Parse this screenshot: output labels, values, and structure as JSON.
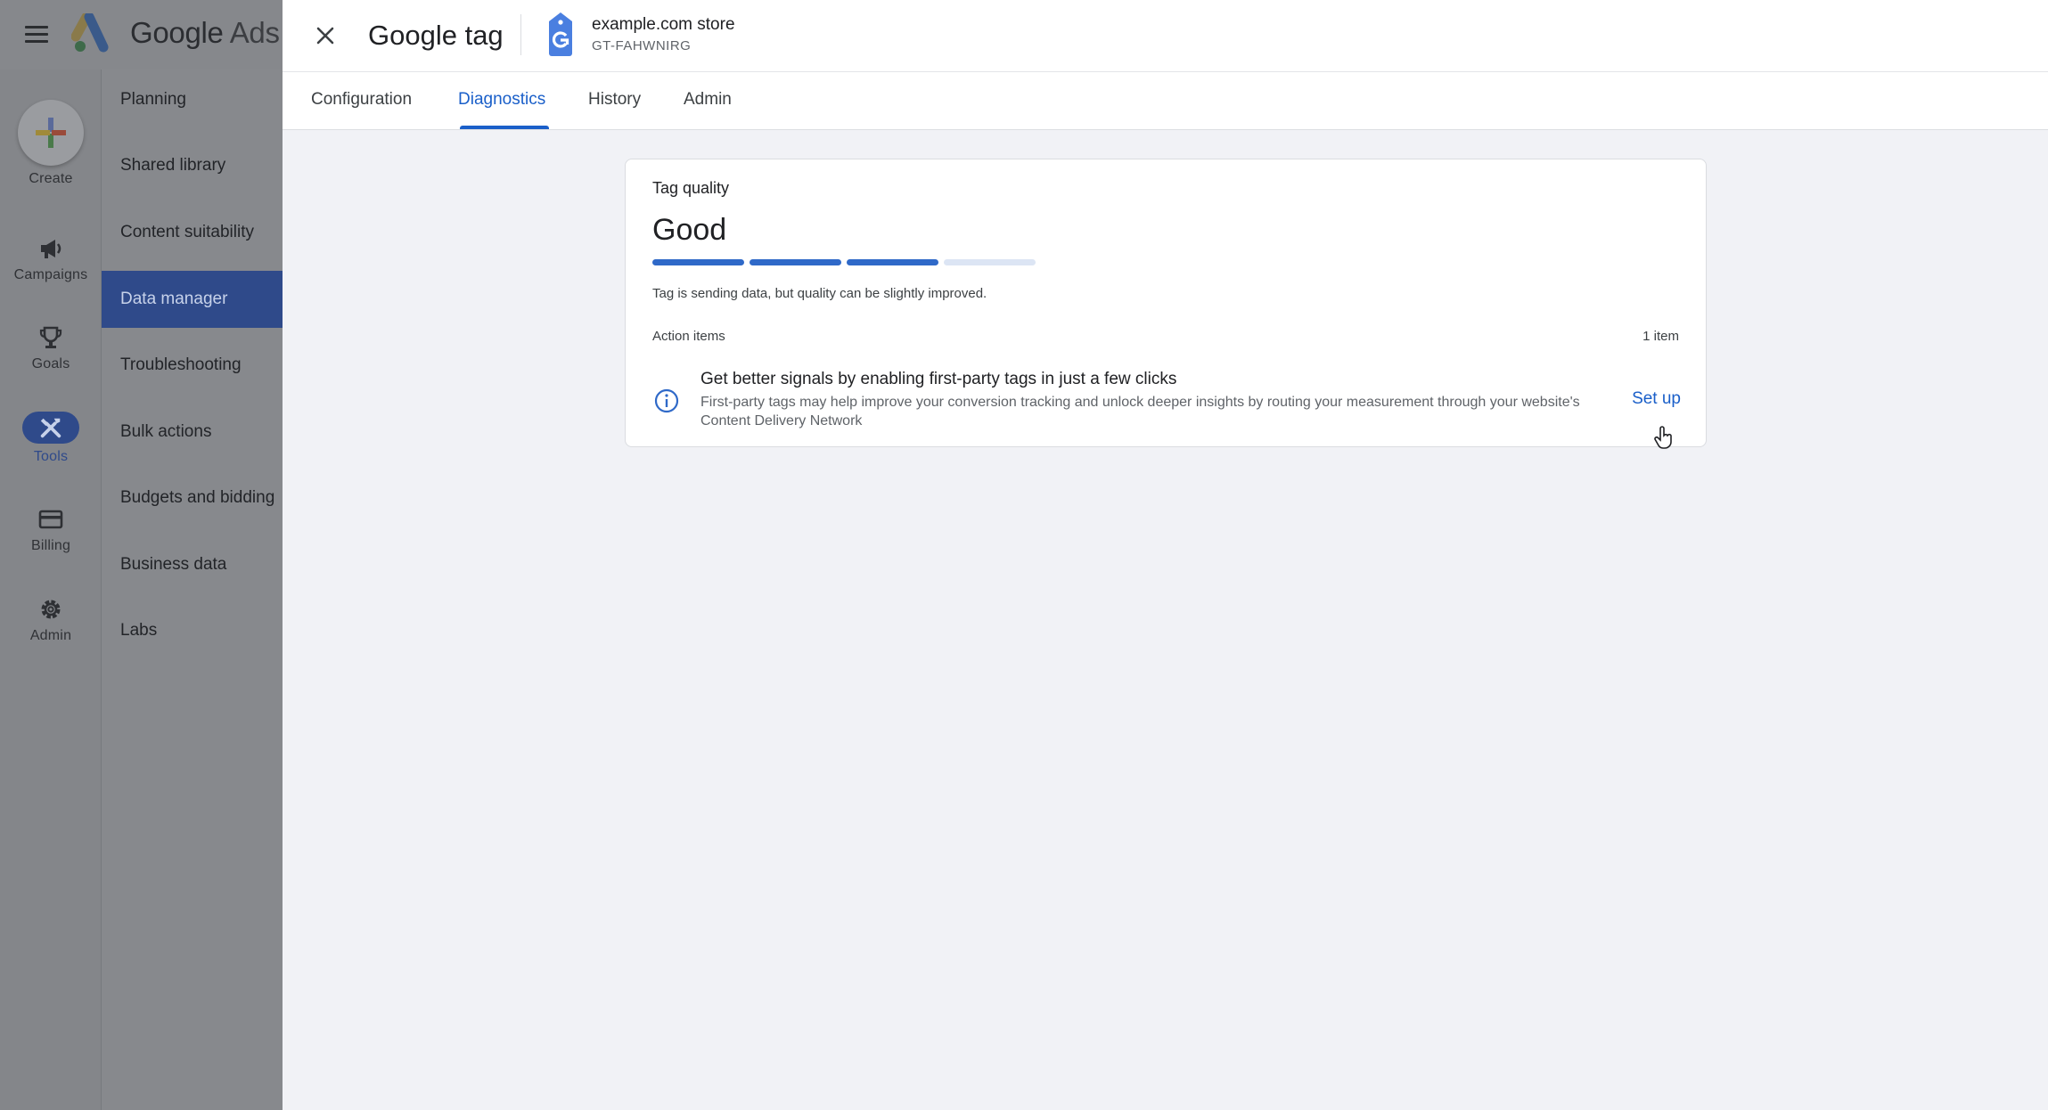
{
  "app": {
    "brand_google": "Google",
    "brand_product": "Ads"
  },
  "rail": {
    "items": [
      {
        "label": "Create",
        "icon": "plus-icon"
      },
      {
        "label": "Campaigns",
        "icon": "megaphone-icon"
      },
      {
        "label": "Goals",
        "icon": "trophy-icon"
      },
      {
        "label": "Tools",
        "icon": "tools-icon",
        "active": true
      },
      {
        "label": "Billing",
        "icon": "credit-card-icon"
      },
      {
        "label": "Admin",
        "icon": "gear-icon"
      }
    ]
  },
  "nav": {
    "items": [
      {
        "label": "Planning"
      },
      {
        "label": "Shared library"
      },
      {
        "label": "Content suitability"
      },
      {
        "label": "Data manager",
        "active": true
      },
      {
        "label": "Troubleshooting"
      },
      {
        "label": "Bulk actions"
      },
      {
        "label": "Budgets and bidding"
      },
      {
        "label": "Business data"
      },
      {
        "label": "Labs"
      }
    ]
  },
  "header": {
    "title": "Google tag",
    "store_name": "example.com store",
    "store_id": "GT-FAHWNIRG",
    "tag_icon": "google-tag-icon"
  },
  "tabs": [
    {
      "label": "Configuration"
    },
    {
      "label": "Diagnostics",
      "active": true
    },
    {
      "label": "History"
    },
    {
      "label": "Admin"
    }
  ],
  "card": {
    "label": "Tag quality",
    "value": "Good",
    "quality_level": 3,
    "quality_max": 4,
    "description": "Tag is sending data, but quality can be slightly improved.",
    "action_items_label": "Action items",
    "action_items_count": "1 item",
    "action": {
      "icon": "info-icon",
      "title": "Get better signals by enabling first-party tags in just a few clicks",
      "description": "First-party tags may help improve your conversion tracking and unlock deeper insights by routing your measurement through your website's Content Delivery Network",
      "link": "Set up"
    }
  },
  "colors": {
    "accent": "#1a5fc9",
    "bar_on": "#2f69c8",
    "bar_off": "#dce5f4",
    "nav_active": "#2f4a8a"
  }
}
